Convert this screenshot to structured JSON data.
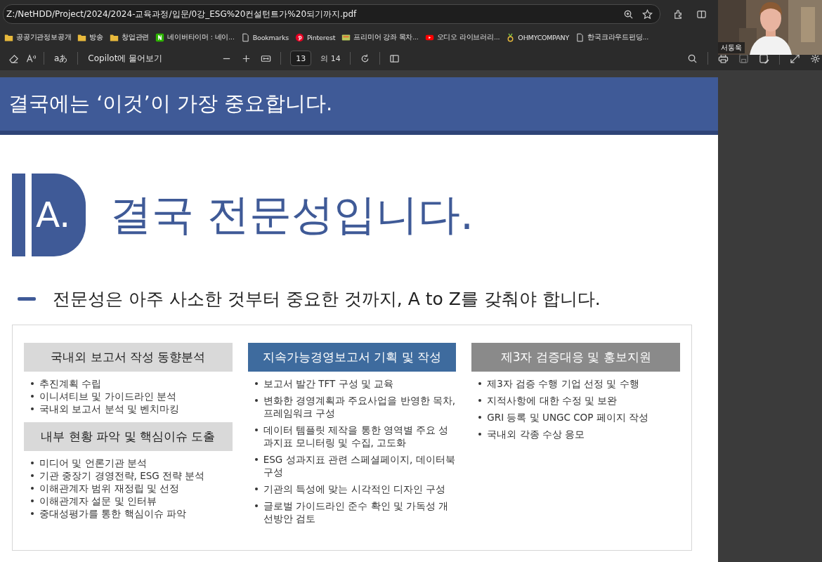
{
  "address_bar": {
    "url": "Z:/NetHDD/Project/2024/2024-교육과정/입문/0강_ESG%20컨설턴트가%20되기까지.pdf"
  },
  "bookmarks": [
    {
      "label": "공공기관정보공개",
      "kind": "folder"
    },
    {
      "label": "방송",
      "kind": "folder"
    },
    {
      "label": "창업관련",
      "kind": "folder"
    },
    {
      "label": "네이버타이머 : 네이...",
      "kind": "naver"
    },
    {
      "label": "Bookmarks",
      "kind": "page"
    },
    {
      "label": "Pinterest",
      "kind": "pinterest"
    },
    {
      "label": "프리미어 강좌 목차...",
      "kind": "thumbnail"
    },
    {
      "label": "오디오 라이브러리...",
      "kind": "video"
    },
    {
      "label": "OHMYCOMPANY",
      "kind": "medal"
    },
    {
      "label": "한국크라우드펀딩...",
      "kind": "page"
    }
  ],
  "pdf_toolbar": {
    "font_button": "aあ",
    "copilot": "Copilot에 물어보기",
    "page": "13",
    "page_total": "의 14"
  },
  "video_tile": {
    "kind": "picture",
    "name": "서동욱"
  },
  "slide": {
    "banner": "결국에는 ‘이것’이 가장 중요합니다.",
    "section_letter": "A.",
    "heading": "결국 전문성입니다.",
    "subheading": "전문성은 아주 사소한 것부터 중요한 것까지, A to Z를 갖춰야 합니다.",
    "columns": [
      [
        {
          "header": "국내외 보고서 작성 동향분석",
          "kind": "light",
          "items": [
            "추진계획 수립",
            "이니셔티브 및 가이드라인 분석",
            "국내외 보고서 분석 및 벤치마킹"
          ]
        },
        {
          "header": "내부 현황 파악 및 핵심이슈 도출",
          "kind": "light",
          "items": [
            "미디어 및 언론기관 분석",
            "기관 중장기 경영전략, ESG 전략 분석",
            "이해관계자 범위 재정립 및 선정",
            "이해관계자 설문 및 인터뷰",
            "중대성평가를 통한 핵심이슈 파악"
          ]
        }
      ],
      [
        {
          "header": "지속가능경영보고서 기획 및 작성",
          "kind": "accent",
          "items": [
            "보고서 발간 TFT 구성 및 교육",
            "변화한 경영계획과 주요사업을 반영한 목차, 프레임워크 구성",
            "데이터 템플릿 제작을 통한 영역별 주요 성과지표 모니터링 및 수집, 고도화",
            "ESG 성과지표 관련 스페셜페이지, 데이터북 구성",
            "기관의 특성에 맞는 시각적인 디자인 구성",
            "글로벌 가이드라인 준수 확인 및 가독성 개선방안 검토"
          ]
        }
      ],
      [
        {
          "header": "제3자 검증대응 및 홍보지원",
          "kind": "muted",
          "items": [
            "제3자 검증 수행 기업 선정 및 수행",
            "지적사항에 대한 수정 및 보완",
            "GRI 등록 및 UNGC COP 페이지 작성",
            "국내외 각종 수상 응모"
          ]
        }
      ]
    ]
  }
}
